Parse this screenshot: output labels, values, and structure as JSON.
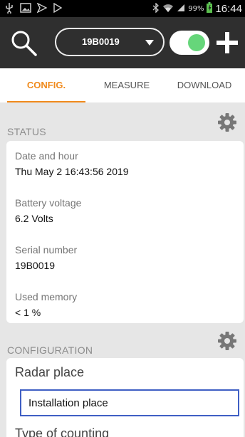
{
  "status_bar": {
    "icons_left": [
      "usb-icon",
      "image-icon",
      "send-icon",
      "play-icon"
    ],
    "icons_right": [
      "bluetooth-icon",
      "wifi-icon",
      "signal-icon",
      "battery-icon"
    ],
    "battery_percent": "99%",
    "time": "16:44"
  },
  "toolbar": {
    "device_id": "19B0019",
    "toggle_on": true,
    "accent_color": "#66d67a"
  },
  "tabs": [
    {
      "label": "CONFIG.",
      "active": true
    },
    {
      "label": "MEASURE",
      "active": false
    },
    {
      "label": "DOWNLOAD",
      "active": false
    }
  ],
  "status": {
    "header": "STATUS",
    "fields": [
      {
        "label": "Date and hour",
        "value": "Thu May 2 16:43:56 2019"
      },
      {
        "label": "Battery voltage",
        "value": "6.2 Volts"
      },
      {
        "label": "Serial number",
        "value": "19B0019"
      },
      {
        "label": "Used memory",
        "value": "< 1 %"
      }
    ]
  },
  "configuration": {
    "header": "CONFIGURATION",
    "radar_place_label": "Radar place",
    "radar_place_value": "Installation place",
    "type_of_counting_label": "Type of counting"
  },
  "colors": {
    "tab_active": "#f08a1c",
    "toolbar_bg": "#2f2f2f",
    "input_border": "#3f5fc4"
  }
}
